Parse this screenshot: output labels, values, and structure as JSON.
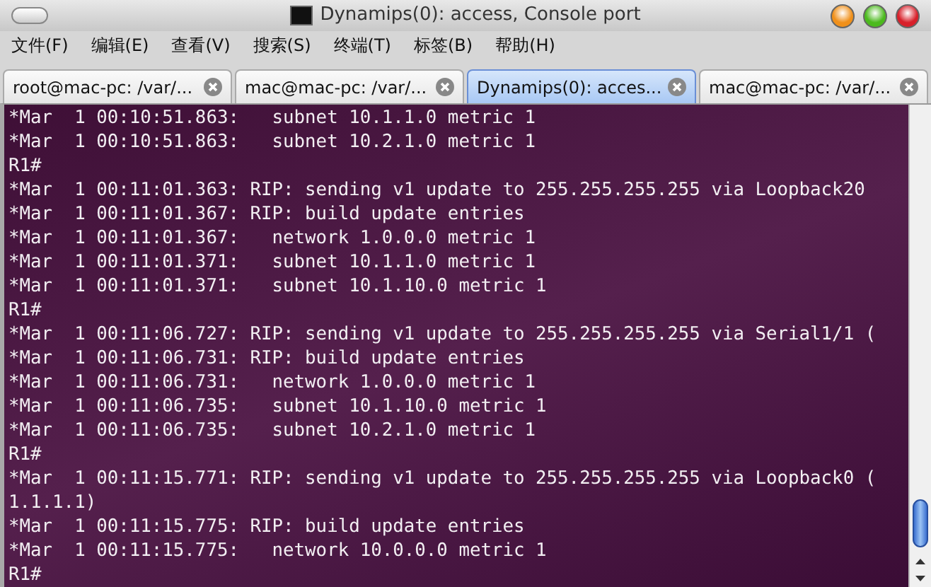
{
  "window": {
    "title": "Dynamips(0): access, Console port"
  },
  "menu": [
    "文件(F)",
    "编辑(E)",
    "查看(V)",
    "搜索(S)",
    "终端(T)",
    "标签(B)",
    "帮助(H)"
  ],
  "tabs": [
    {
      "label": "root@mac-pc: /var/...",
      "selected": false
    },
    {
      "label": "mac@mac-pc: /var/...",
      "selected": false
    },
    {
      "label": "Dynamips(0): acces...",
      "selected": true
    },
    {
      "label": "mac@mac-pc: /var/...",
      "selected": false
    }
  ],
  "terminal_lines": [
    "*Mar  1 00:10:51.863:   subnet 10.1.1.0 metric 1",
    "*Mar  1 00:10:51.863:   subnet 10.2.1.0 metric 1",
    "R1#",
    "*Mar  1 00:11:01.363: RIP: sending v1 update to 255.255.255.255 via Loopback20",
    "*Mar  1 00:11:01.367: RIP: build update entries",
    "*Mar  1 00:11:01.367:   network 1.0.0.0 metric 1",
    "*Mar  1 00:11:01.371:   subnet 10.1.1.0 metric 1",
    "*Mar  1 00:11:01.371:   subnet 10.1.10.0 metric 1",
    "R1#",
    "*Mar  1 00:11:06.727: RIP: sending v1 update to 255.255.255.255 via Serial1/1 (",
    "*Mar  1 00:11:06.731: RIP: build update entries",
    "*Mar  1 00:11:06.731:   network 1.0.0.0 metric 1",
    "*Mar  1 00:11:06.735:   subnet 10.1.10.0 metric 1",
    "*Mar  1 00:11:06.735:   subnet 10.2.1.0 metric 1",
    "R1#",
    "*Mar  1 00:11:15.771: RIP: sending v1 update to 255.255.255.255 via Loopback0 (",
    "1.1.1.1)",
    "*Mar  1 00:11:15.775: RIP: build update entries",
    "*Mar  1 00:11:15.775:   network 10.0.0.0 metric 1",
    "R1#"
  ]
}
